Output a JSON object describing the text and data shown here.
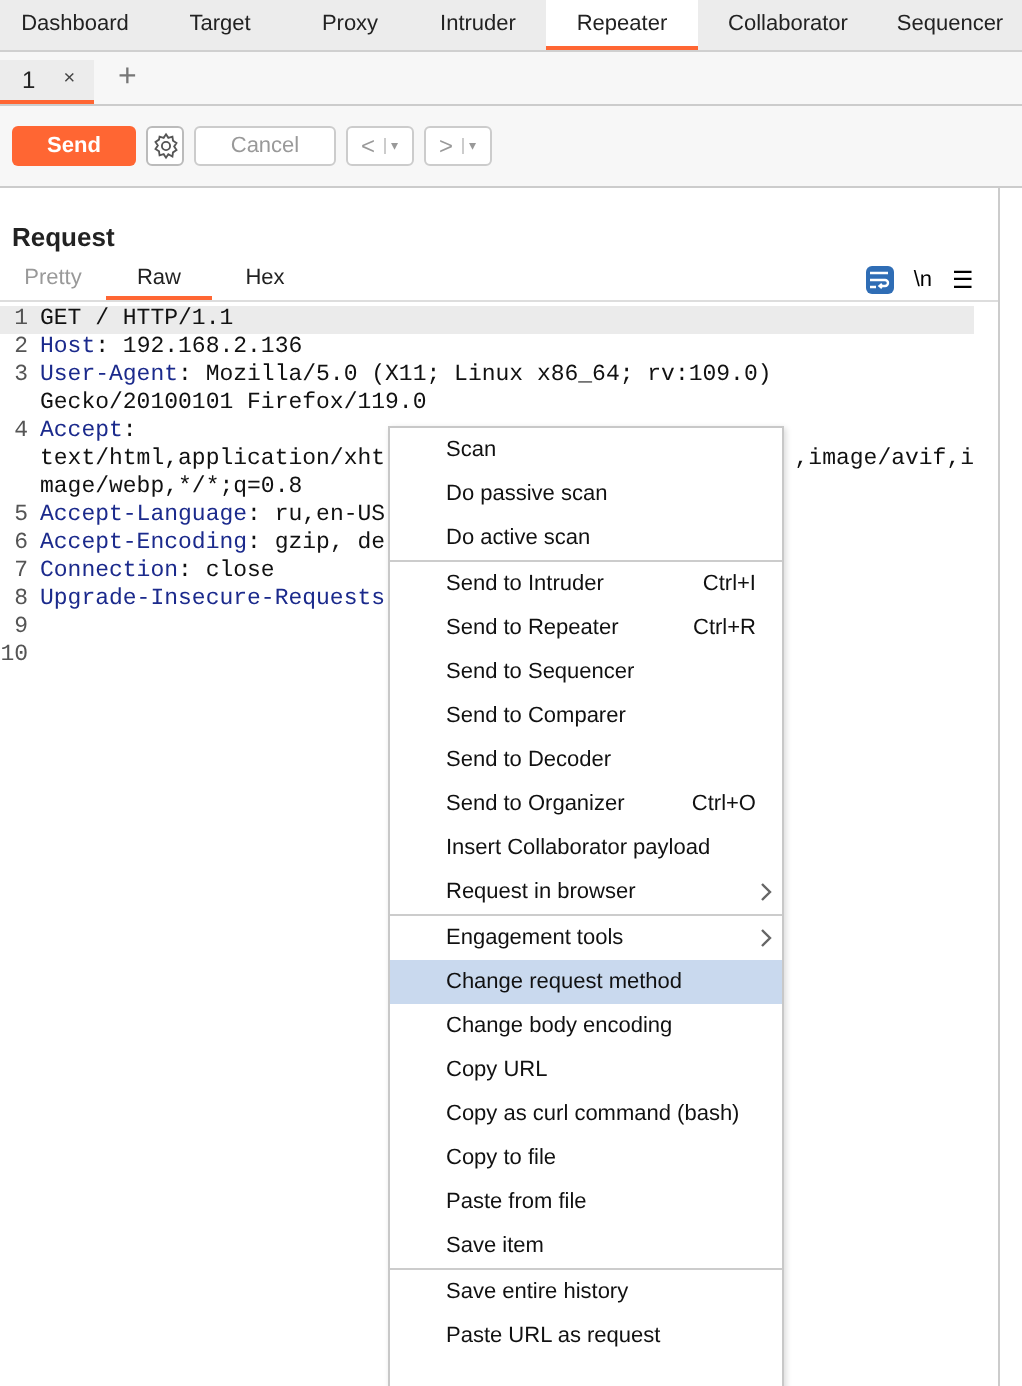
{
  "tabs": [
    {
      "label": "Dashboard",
      "selected": false
    },
    {
      "label": "Target",
      "selected": false
    },
    {
      "label": "Proxy",
      "selected": false
    },
    {
      "label": "Intruder",
      "selected": false
    },
    {
      "label": "Repeater",
      "selected": true
    },
    {
      "label": "Collaborator",
      "selected": false
    },
    {
      "label": "Sequencer",
      "selected": false
    }
  ],
  "subtabs": [
    {
      "label": "1",
      "close": "×",
      "selected": true
    }
  ],
  "add_tab": "+",
  "toolbar": {
    "send": "Send",
    "cancel": "Cancel",
    "back": "<",
    "forward": ">",
    "dropdown": "▾"
  },
  "request": {
    "title": "Request",
    "view_tabs": [
      {
        "label": "Pretty",
        "selected": false,
        "disabled": true
      },
      {
        "label": "Raw",
        "selected": true,
        "disabled": false
      },
      {
        "label": "Hex",
        "selected": false,
        "disabled": false
      }
    ],
    "wrap_on": true,
    "newline_toggle": "\\n",
    "menu_glyph": "☰",
    "lines": [
      {
        "number": "1",
        "current": true,
        "rows": [
          {
            "text": "GET / HTTP/1.1"
          }
        ]
      },
      {
        "number": "2",
        "current": false,
        "rows": [
          {
            "name": "Host",
            "text": ": 192.168.2.136"
          }
        ]
      },
      {
        "number": "3",
        "current": false,
        "rows": [
          {
            "name": "User-Agent",
            "text": ": Mozilla/5.0 (X11; Linux x86_64; rv:109.0)"
          },
          {
            "text": "Gecko/20100101 Firefox/119.0"
          }
        ]
      },
      {
        "number": "4",
        "current": false,
        "rows": [
          {
            "name": "Accept",
            "text": ":"
          },
          {
            "text": "text/html,application/xht",
            "tail": ",image/avif,i"
          },
          {
            "text": "mage/webp,*/*;q=0.8"
          }
        ]
      },
      {
        "number": "5",
        "current": false,
        "rows": [
          {
            "name": "Accept-Language",
            "text": ": ru,en-US"
          }
        ]
      },
      {
        "number": "6",
        "current": false,
        "rows": [
          {
            "name": "Accept-Encoding",
            "text": ": gzip, de"
          }
        ]
      },
      {
        "number": "7",
        "current": false,
        "rows": [
          {
            "name": "Connection",
            "text": ": close"
          }
        ]
      },
      {
        "number": "8",
        "current": false,
        "rows": [
          {
            "name": "Upgrade-Insecure-Requests"
          }
        ]
      },
      {
        "number": "9",
        "current": false
      },
      {
        "number": "10",
        "current": false
      }
    ]
  },
  "context_menu": {
    "groups": [
      [
        {
          "label": "Scan",
          "selected": false,
          "submenu": false
        },
        {
          "label": "Do passive scan",
          "selected": false,
          "submenu": false
        },
        {
          "label": "Do active scan",
          "selected": false,
          "submenu": false
        }
      ],
      [
        {
          "label": "Send to Intruder",
          "shortcut": "Ctrl+I",
          "selected": false,
          "submenu": false
        },
        {
          "label": "Send to Repeater",
          "shortcut": "Ctrl+R",
          "selected": false,
          "submenu": false
        },
        {
          "label": "Send to Sequencer",
          "selected": false,
          "submenu": false
        },
        {
          "label": "Send to Comparer",
          "selected": false,
          "submenu": false
        },
        {
          "label": "Send to Decoder",
          "selected": false,
          "submenu": false
        },
        {
          "label": "Send to Organizer",
          "shortcut": "Ctrl+O",
          "selected": false,
          "submenu": false
        },
        {
          "label": "Insert Collaborator payload",
          "selected": false,
          "submenu": false
        },
        {
          "label": "Request in browser",
          "selected": false,
          "submenu": true
        }
      ],
      [
        {
          "label": "Engagement tools",
          "selected": false,
          "submenu": true
        },
        {
          "label": "Change request method",
          "selected": true,
          "submenu": false
        },
        {
          "label": "Change body encoding",
          "selected": false,
          "submenu": false
        },
        {
          "label": "Copy URL",
          "selected": false,
          "submenu": false
        },
        {
          "label": "Copy as curl command (bash)",
          "selected": false,
          "submenu": false
        },
        {
          "label": "Copy to file",
          "selected": false,
          "submenu": false
        },
        {
          "label": "Paste from file",
          "selected": false,
          "submenu": false
        },
        {
          "label": "Save item",
          "selected": false,
          "submenu": false
        }
      ],
      [
        {
          "label": "Save entire history",
          "selected": false,
          "submenu": false
        },
        {
          "label": "Paste URL as request",
          "selected": false,
          "submenu": false
        }
      ]
    ]
  }
}
